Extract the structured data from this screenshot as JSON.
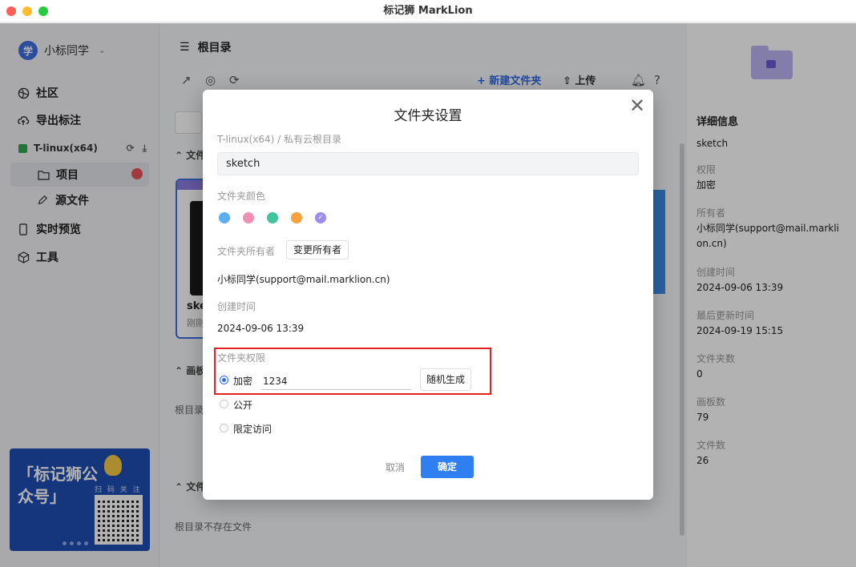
{
  "window": {
    "title": "标记狮 MarkLion"
  },
  "sidebar": {
    "avatar_letter": "学",
    "user_name": "小标同学",
    "items": [
      {
        "label": "社区",
        "icon": "globe-icon"
      },
      {
        "label": "导出标注",
        "icon": "cloud-upload-icon"
      },
      {
        "label": "T-linux(x64)",
        "icon": "workspace-square"
      },
      {
        "label": "项目",
        "icon": "folder-icon"
      },
      {
        "label": "源文件",
        "icon": "pen-icon"
      },
      {
        "label": "实时预览",
        "icon": "phone-icon"
      },
      {
        "label": "工具",
        "icon": "cube-icon"
      }
    ],
    "promo": {
      "title": "「标记狮公众号」",
      "scan_text": "扫 码 关 注"
    }
  },
  "main": {
    "breadcrumb": "根目录",
    "new_folder": "新建文件夹",
    "upload": "上传",
    "section_files": "文件",
    "section_boards": "画板",
    "section_docs": "文件",
    "card_name": "ske",
    "card_sub": "刚刚",
    "root_label": "根目录",
    "empty_text": "根目录不存在文件"
  },
  "detail": {
    "heading": "详细信息",
    "name": "sketch",
    "fields": [
      {
        "label": "权限",
        "value": "加密"
      },
      {
        "label": "所有者",
        "value": "小标同学(support@mail.marklion.cn)"
      },
      {
        "label": "创建时间",
        "value": "2024-09-06 13:39"
      },
      {
        "label": "最后更新时间",
        "value": "2024-09-19 15:15"
      },
      {
        "label": "文件夹数",
        "value": "0"
      },
      {
        "label": "画板数",
        "value": "79"
      },
      {
        "label": "文件数",
        "value": "26"
      }
    ]
  },
  "modal": {
    "title": "文件夹设置",
    "path": "T-linux(x64) / 私有云根目录",
    "folder_name": "sketch",
    "color_label": "文件夹颜色",
    "colors": [
      "#5aaef2",
      "#f48fb4",
      "#3fc49b",
      "#f7a23e",
      "#9b8cf0"
    ],
    "selected_color_check": "✓",
    "owner_label": "文件夹所有者",
    "change_owner": "变更所有者",
    "owner_value": "小标同学(support@mail.marklion.cn)",
    "created_label": "创建时间",
    "created_value": "2024-09-06 13:39",
    "perm_label": "文件夹权限",
    "perm_options": [
      "加密",
      "公开",
      "限定访问"
    ],
    "selected_perm": "加密",
    "password": "1234",
    "random_btn": "随机生成",
    "cancel": "取消",
    "confirm": "确定"
  }
}
